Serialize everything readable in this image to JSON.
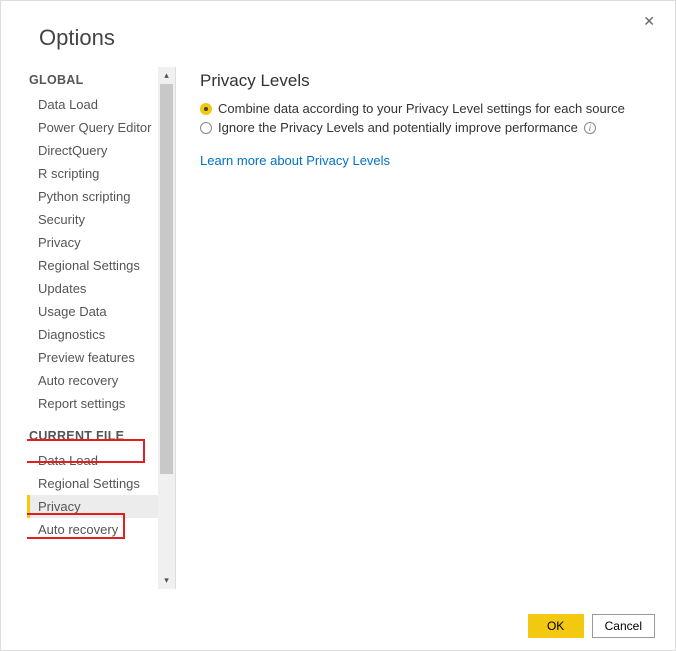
{
  "dialog": {
    "title": "Options",
    "close": "✕"
  },
  "sidebar": {
    "sections": [
      {
        "header": "GLOBAL",
        "items": [
          "Data Load",
          "Power Query Editor",
          "DirectQuery",
          "R scripting",
          "Python scripting",
          "Security",
          "Privacy",
          "Regional Settings",
          "Updates",
          "Usage Data",
          "Diagnostics",
          "Preview features",
          "Auto recovery",
          "Report settings"
        ]
      },
      {
        "header": "CURRENT FILE",
        "items": [
          "Data Load",
          "Regional Settings",
          "Privacy",
          "Auto recovery"
        ]
      }
    ],
    "selected": "Privacy"
  },
  "content": {
    "heading": "Privacy Levels",
    "radios": [
      {
        "label": "Combine data according to your Privacy Level settings for each source",
        "selected": true,
        "info": false
      },
      {
        "label": "Ignore the Privacy Levels and potentially improve performance",
        "selected": false,
        "info": true
      }
    ],
    "link": "Learn more about Privacy Levels"
  },
  "footer": {
    "ok": "OK",
    "cancel": "Cancel"
  },
  "colors": {
    "accent": "#f2c811",
    "link": "#0072c6",
    "highlight": "#e02020"
  }
}
